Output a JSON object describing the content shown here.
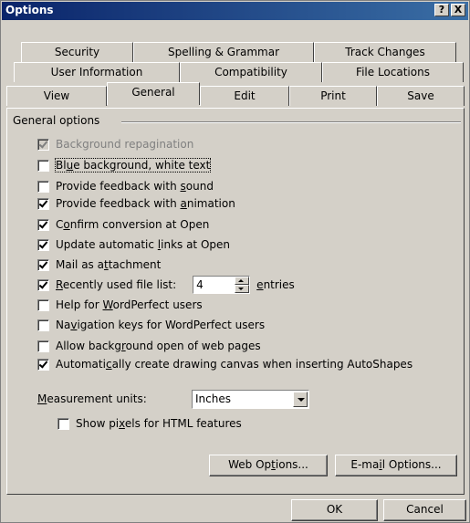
{
  "window": {
    "title": "Options",
    "help_label": "?",
    "close_label": "X"
  },
  "tabs": {
    "row1": [
      {
        "label": "Security"
      },
      {
        "label": "Spelling & Grammar"
      },
      {
        "label": "Track Changes"
      }
    ],
    "row2": [
      {
        "label": "User Information"
      },
      {
        "label": "Compatibility"
      },
      {
        "label": "File Locations"
      }
    ],
    "row3": [
      {
        "label": "View"
      },
      {
        "label": "General"
      },
      {
        "label": "Edit"
      },
      {
        "label": "Print"
      },
      {
        "label": "Save"
      }
    ],
    "active": "General"
  },
  "group": {
    "title": "General options"
  },
  "options": [
    {
      "label_pre": "",
      "mnemonic": "",
      "label_post": "Background repagination",
      "checked": true,
      "disabled": true
    },
    {
      "label_pre": "Bl",
      "mnemonic": "u",
      "label_post": "e background, white text",
      "checked": false,
      "disabled": false
    },
    {
      "label_pre": "Provide feedback with ",
      "mnemonic": "s",
      "label_post": "ound",
      "checked": false,
      "disabled": false
    },
    {
      "label_pre": "Provide feedback with ",
      "mnemonic": "a",
      "label_post": "nimation",
      "checked": true,
      "disabled": false
    },
    {
      "label_pre": "C",
      "mnemonic": "o",
      "label_post": "nfirm conversion at Open",
      "checked": true,
      "disabled": false
    },
    {
      "label_pre": "Update automatic ",
      "mnemonic": "l",
      "label_post": "inks at Open",
      "checked": true,
      "disabled": false
    },
    {
      "label_pre": "Mail as a",
      "mnemonic": "t",
      "label_post": "tachment",
      "checked": true,
      "disabled": false
    },
    {
      "label_pre": "",
      "mnemonic": "R",
      "label_post": "ecently used file list:",
      "checked": true,
      "disabled": false
    },
    {
      "label_pre": "Help for ",
      "mnemonic": "W",
      "label_post": "ordPerfect users",
      "checked": false,
      "disabled": false
    },
    {
      "label_pre": "Na",
      "mnemonic": "v",
      "label_post": "igation keys for WordPerfect users",
      "checked": false,
      "disabled": false
    },
    {
      "label_pre": "Allow backg",
      "mnemonic": "r",
      "label_post": "ound open of web pages",
      "checked": false,
      "disabled": false
    },
    {
      "label_pre": "Automati",
      "mnemonic": "c",
      "label_post": "ally create drawing canvas when inserting AutoShapes",
      "checked": true,
      "disabled": false
    }
  ],
  "recent_files": {
    "value": "4",
    "suffix_mnemonic": "e",
    "suffix_rest": "ntries"
  },
  "measurement": {
    "label_mnemonic": "M",
    "label_rest": "easurement units:",
    "value": "Inches"
  },
  "pixels_option": {
    "label_pre": "Show pi",
    "mnemonic": "x",
    "label_post": "els for HTML features",
    "checked": false
  },
  "buttons": {
    "web_options_pre": "Web Op",
    "web_options_mn": "t",
    "web_options_post": "ions...",
    "email_options_pre": "E-ma",
    "email_options_mn": "i",
    "email_options_post": "l Options...",
    "ok": "OK",
    "cancel": "Cancel"
  }
}
